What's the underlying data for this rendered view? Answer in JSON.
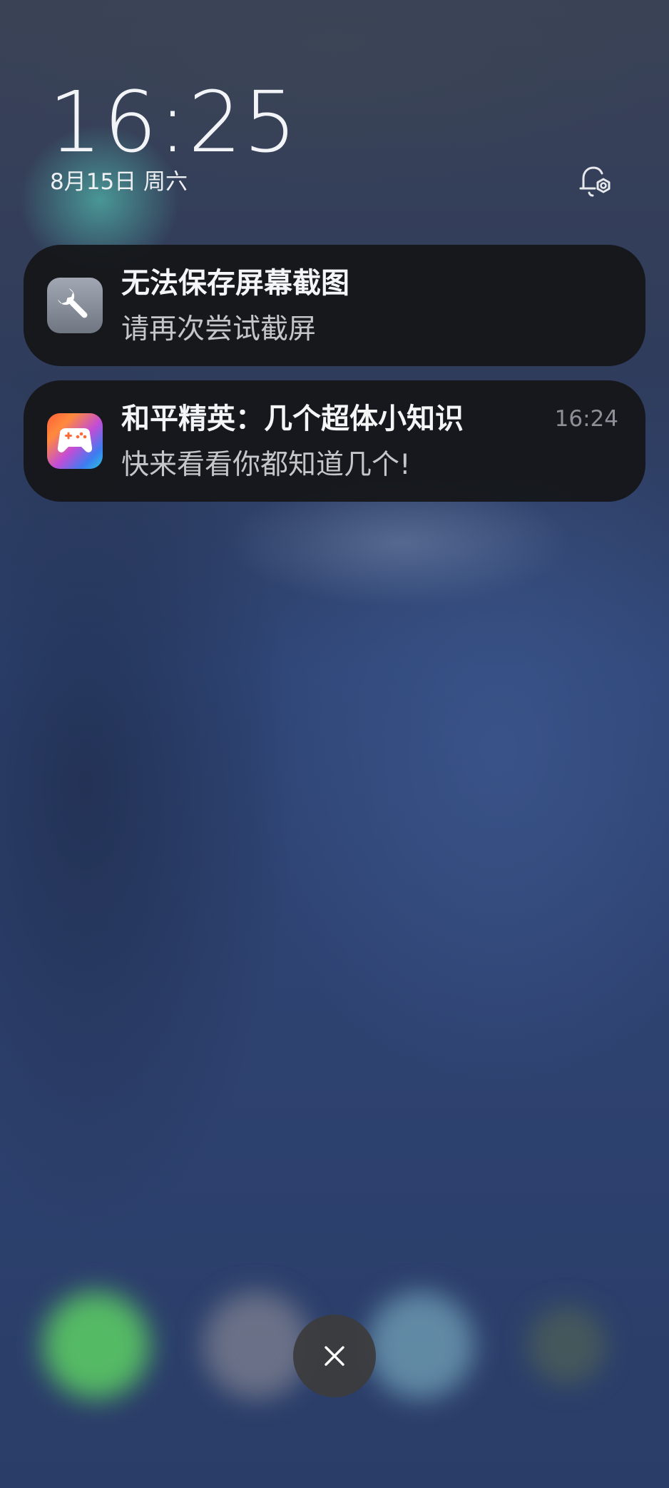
{
  "lockscreen": {
    "time": "16:25",
    "date": "8月15日 周六",
    "settings_icon": "bell-gear-icon"
  },
  "notifications": [
    {
      "app_icon": "wrench-icon",
      "title": "无法保存屏幕截图",
      "body": "请再次尝试截屏",
      "time": ""
    },
    {
      "app_icon": "gamepad-icon",
      "title": "和平精英：几个超体小知识",
      "body": "快来看看你都知道几个!",
      "time": "16:24"
    }
  ],
  "dismiss": {
    "icon": "close-icon"
  },
  "colors": {
    "card_background": "#141518",
    "accent_text": "#f4f5f7",
    "secondary_text": "#c4c6ca"
  }
}
